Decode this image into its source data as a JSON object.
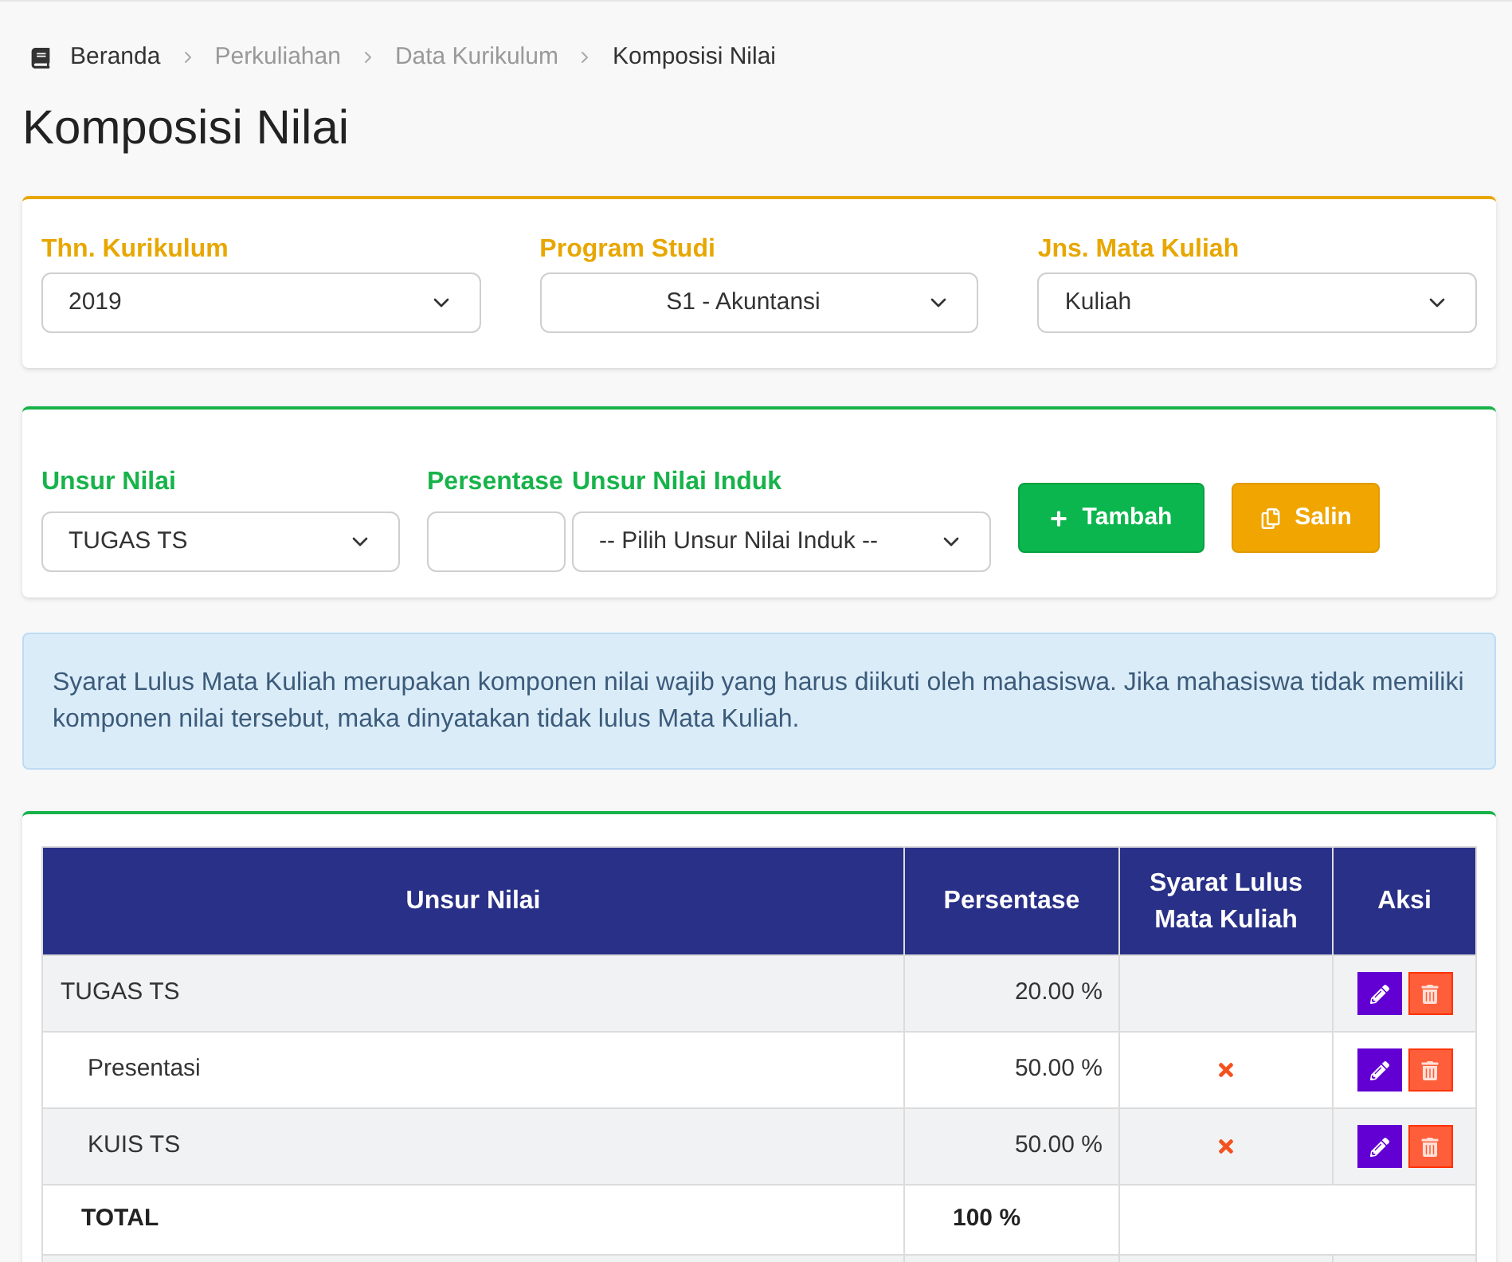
{
  "breadcrumb": [
    {
      "label": "Beranda",
      "muted": false
    },
    {
      "label": "Perkuliahan",
      "muted": true
    },
    {
      "label": "Data Kurikulum",
      "muted": true
    },
    {
      "label": "Komposisi Nilai",
      "muted": false
    }
  ],
  "page_title": "Komposisi Nilai",
  "filters": [
    {
      "label": "Thn. Kurikulum",
      "value": "2019"
    },
    {
      "label": "Program Studi",
      "value": "S1 - Akuntansi"
    },
    {
      "label": "Jns. Mata Kuliah",
      "value": "Kuliah"
    }
  ],
  "form": {
    "unsur_nilai": {
      "label": "Unsur Nilai",
      "value": "TUGAS TS"
    },
    "persentase": {
      "label": "Persentase"
    },
    "induk": {
      "label": "Unsur Nilai Induk",
      "value": "-- Pilih Unsur Nilai Induk --"
    },
    "buttons": [
      {
        "label": "Tambah",
        "kind": "add"
      },
      {
        "label": "Salin",
        "kind": "copy"
      }
    ]
  },
  "info": "Syarat Lulus Mata Kuliah merupakan komponen nilai wajib yang harus diikuti oleh mahasiswa. Jika mahasiswa tidak memiliki komponen nilai tersebut, maka dinyatakan tidak lulus Mata Kuliah.",
  "table": {
    "columns": [
      "Unsur Nilai",
      "Persentase",
      "Syarat Lulus Mata Kuliah",
      "Aksi"
    ],
    "rows": [
      {
        "name": "TUGAS TS",
        "percent": "20.00 %",
        "children": [
          {
            "name": "Presentasi",
            "percent": "50.00 %",
            "syarat_lulus": false
          },
          {
            "name": "KUIS TS",
            "percent": "50.00 %",
            "syarat_lulus": false
          }
        ]
      }
    ],
    "total": {
      "label": "TOTAL",
      "value": "100 %"
    }
  }
}
